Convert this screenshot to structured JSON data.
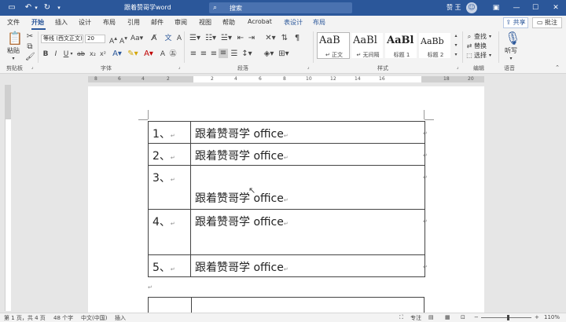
{
  "titlebar": {
    "autosave_icon": "save-icon",
    "undo_icon": "undo-icon",
    "redo_icon": "redo-icon",
    "customize_icon": "chevron-down-icon",
    "title": "跟着赞哥学word",
    "search_placeholder": "搜索",
    "user_name": "赞 王",
    "avatar_initial": "☺",
    "ribbon_display": "▣",
    "minimize": "—",
    "maximize": "☐",
    "close": "✕"
  },
  "tabs": [
    {
      "label": "文件",
      "active": false
    },
    {
      "label": "开始",
      "active": true
    },
    {
      "label": "插入",
      "active": false
    },
    {
      "label": "设计",
      "active": false
    },
    {
      "label": "布局",
      "active": false
    },
    {
      "label": "引用",
      "active": false
    },
    {
      "label": "邮件",
      "active": false
    },
    {
      "label": "审阅",
      "active": false
    },
    {
      "label": "视图",
      "active": false
    },
    {
      "label": "帮助",
      "active": false
    },
    {
      "label": "Acrobat",
      "active": false
    },
    {
      "label": "表设计",
      "active": false
    },
    {
      "label": "布局",
      "active": false
    }
  ],
  "share": {
    "label": "共享",
    "icon": "share-icon"
  },
  "comment": {
    "label": "批注",
    "icon": "comment-icon"
  },
  "ribbon": {
    "clipboard": {
      "paste_label": "粘贴",
      "group_label": "剪贴板"
    },
    "font": {
      "font_name": "等线 (西文正文)",
      "font_size": "20",
      "group_label": "字体"
    },
    "paragraph": {
      "group_label": "段落"
    },
    "styles": {
      "group_label": "样式",
      "items": [
        {
          "preview": "AaB",
          "name": "↵ 正文",
          "selected": true
        },
        {
          "preview": "AaBl",
          "name": "↵ 无间隔",
          "selected": false
        },
        {
          "preview": "AaBl",
          "name": "标题 1",
          "selected": false
        },
        {
          "preview": "AaBb",
          "name": "标题 2",
          "selected": false
        }
      ]
    },
    "editing": {
      "find": "查找",
      "replace": "替换",
      "select": "选择",
      "group_label": "编辑"
    },
    "voice": {
      "dictate": "听写",
      "group_label": "语音"
    }
  },
  "ruler": {
    "numbers": [
      "8",
      "6",
      "4",
      "2",
      "2",
      "4",
      "6",
      "8",
      "10",
      "12",
      "14",
      "16",
      "18",
      "20"
    ]
  },
  "document": {
    "rows": [
      {
        "num": "1、",
        "text": "跟着赞哥学 office"
      },
      {
        "num": "2、",
        "text": "跟着赞哥学 office"
      },
      {
        "num": "3、",
        "text": "跟着赞哥学 office"
      },
      {
        "num": "4、",
        "text": "跟着赞哥学 office"
      },
      {
        "num": "5、",
        "text": "跟着赞哥学 office"
      }
    ],
    "cell_mark": "↵"
  },
  "statusbar": {
    "page": "第 1 页，共 4 页",
    "words": "48 个字",
    "language": "中文(中国)",
    "mode": "插入",
    "zoom_minus": "−",
    "zoom_plus": "+",
    "zoom": "110%"
  }
}
